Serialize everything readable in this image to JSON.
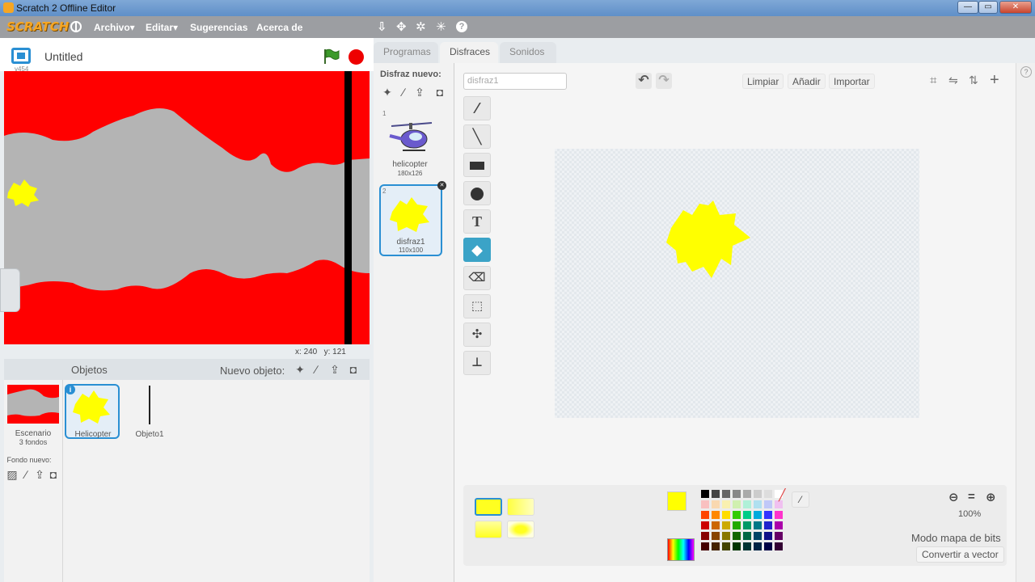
{
  "window": {
    "title": "Scratch 2 Offline Editor",
    "minimize": "—",
    "maximize": "▭",
    "close": "✕"
  },
  "menu": {
    "logo": "SCRATCH",
    "items": [
      "Archivo▾",
      "Editar▾",
      "Sugerencias",
      "Acerca de"
    ],
    "tools": [
      "⇩",
      "✥",
      "✲",
      "✳",
      "?"
    ]
  },
  "stage": {
    "version": "v454",
    "project_title": "Untitled",
    "coords_x_label": "x:",
    "coords_x": "240",
    "coords_y_label": "y:",
    "coords_y": "121",
    "colors": {
      "background": "#ff0000",
      "terrain": "#b4b4b4",
      "sprite": "#ffff00",
      "bar": "#000000"
    }
  },
  "sprites": {
    "header": "Objetos",
    "new_sprite_label": "Nuevo objeto:",
    "stage_label": "Escenario",
    "stage_backdrops": "3 fondos",
    "new_backdrop_label": "Fondo nuevo:",
    "items": [
      {
        "name": "Helicopter",
        "selected": true
      },
      {
        "name": "Objeto1",
        "selected": false
      }
    ]
  },
  "tabs": [
    "Programas",
    "Disfraces",
    "Sonidos"
  ],
  "active_tab": "Disfraces",
  "costumes": {
    "new_label": "Disfraz nuevo:",
    "list": [
      {
        "index": "1",
        "name": "helicopter",
        "size": "180x126"
      },
      {
        "index": "2",
        "name": "disfraz1",
        "size": "110x100",
        "selected": true
      }
    ]
  },
  "editor": {
    "costume_name": "disfraz1",
    "buttons": {
      "clear": "Limpiar",
      "add": "Añadir",
      "import": "Importar"
    },
    "tools": [
      "brush",
      "line",
      "rectangle",
      "ellipse",
      "text",
      "fill",
      "eraser",
      "select",
      "magic-select",
      "stamp"
    ],
    "active_tool": "fill",
    "zoom": "100%",
    "mode_label": "Modo mapa de bits",
    "convert_button": "Convertir a vector",
    "fill_color": "#ffff00"
  }
}
